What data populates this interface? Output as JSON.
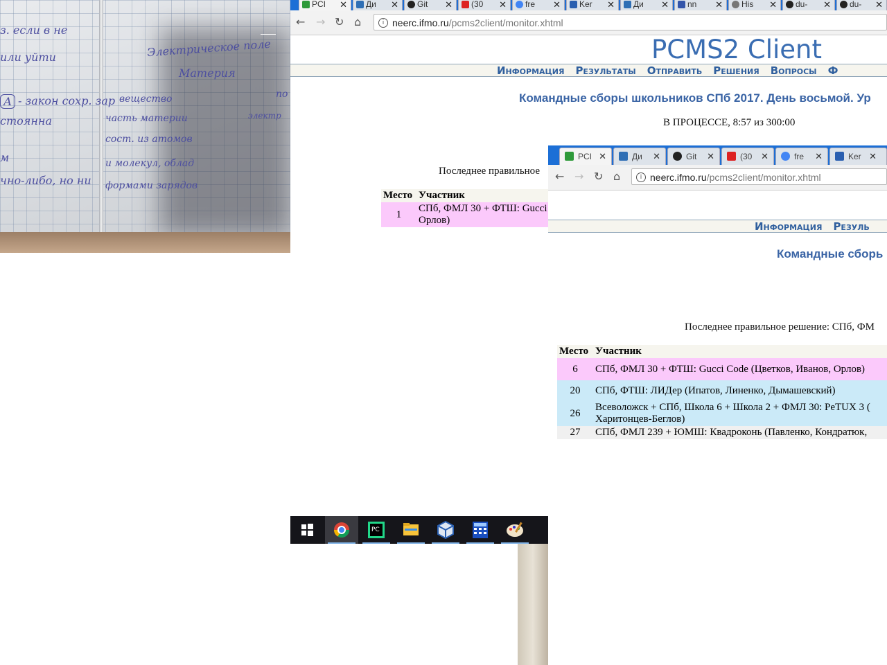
{
  "photo": {
    "handwriting": [
      "з. если в не",
      "или уйти",
      "А",
      "- закон сохр. зар",
      "стоянна",
      "м",
      "чно-либо, но ни",
      "Электрическое поле",
      "Материя",
      "вещество",
      "часть материи",
      "сост. из атомов",
      "и молекул, облад",
      "формами зарядов",
      "по",
      "электр"
    ]
  },
  "back_browser": {
    "tabs": [
      {
        "label": "PCI",
        "icon": "pcms-icon",
        "color": "#2e9a3a"
      },
      {
        "label": "Ди",
        "icon": "chat-icon",
        "color": "#2f6fb5"
      },
      {
        "label": "Git",
        "icon": "github-icon",
        "color": "#222222"
      },
      {
        "label": "(30",
        "icon": "youtube-icon",
        "color": "#d22"
      },
      {
        "label": "fre",
        "icon": "google-icon",
        "color": "#4285f4"
      },
      {
        "label": "Ker",
        "icon": "kotlin-icon",
        "color": "#2a5fb0"
      },
      {
        "label": "Ди",
        "icon": "chat-icon",
        "color": "#2f6fb5"
      },
      {
        "label": "nn",
        "icon": "nn-icon",
        "color": "#3355aa"
      },
      {
        "label": "His",
        "icon": "history-icon",
        "color": "#777777"
      },
      {
        "label": "du-",
        "icon": "github-icon",
        "color": "#222222"
      },
      {
        "label": "du-",
        "icon": "github-icon",
        "color": "#222222"
      }
    ],
    "url_domain": "neerc.ifmo.ru",
    "url_path": "/pcms2client/monitor.xhtml",
    "site_title": "PCMS2 Client",
    "menu": [
      "Информация",
      "Результаты",
      "Отправить",
      "Решения",
      "Вопросы",
      "Ф"
    ],
    "contest_title": "Командные сборы школьников СПб 2017. День восьмой. Ур",
    "status": "В ПРОЦЕССЕ, 8:57 из 300:00",
    "last_correct": "Последнее правильное",
    "table": {
      "headers": [
        "Место",
        "Участник"
      ],
      "rows": [
        {
          "place": "1",
          "team": "СПб, ФМЛ 30 + ФТШ: Gucci",
          "team2": "Орлов)"
        }
      ]
    }
  },
  "taskbar": {
    "items": [
      "windows-start-icon",
      "chrome-icon",
      "pycharm-icon",
      "file-explorer-icon",
      "virtualbox-icon",
      "calculator-icon",
      "paint-icon"
    ]
  },
  "front_browser": {
    "tabs": [
      {
        "label": "PCI",
        "icon": "pcms-icon",
        "color": "#2e9a3a"
      },
      {
        "label": "Ди",
        "icon": "chat-icon",
        "color": "#2f6fb5"
      },
      {
        "label": "Git",
        "icon": "github-icon",
        "color": "#222222"
      },
      {
        "label": "(30",
        "icon": "youtube-icon",
        "color": "#d22"
      },
      {
        "label": "fre",
        "icon": "google-icon",
        "color": "#4285f4"
      },
      {
        "label": "Ker",
        "icon": "kotlin-icon",
        "color": "#2a5fb0"
      }
    ],
    "url_domain": "neerc.ifmo.ru",
    "url_path": "/pcms2client/monitor.xhtml",
    "menu": [
      "Информация",
      "Резуль"
    ],
    "contest_title": "Командные сборь",
    "last_correct": "Последнее правильное решение: СПб, ФМ",
    "table": {
      "headers": [
        "Место",
        "Участник"
      ],
      "rows": [
        {
          "place": "6",
          "team": "СПб, ФМЛ 30 + ФТШ: Gucci Code (Цветков, Иванов, Орлов)",
          "team2": "",
          "style": "pink"
        },
        {
          "place": "20",
          "team": "СПб, ФТШ: ЛИДер (Ипатов, Линенко, Дымашевский)",
          "team2": "",
          "style": "blue"
        },
        {
          "place": "26",
          "team": "Всеволожск + СПб, Школа 6 + Школа 2 + ФМЛ 30: PeTUX 3 (",
          "team2": "Харитонцев-Беглов)",
          "style": "blue"
        },
        {
          "place": "27",
          "team": "СПб, ФМЛ 239 + ЮМШ: Квадроконь (Павленко, Кондратюк,",
          "team2": "",
          "style": "grey"
        }
      ]
    }
  }
}
